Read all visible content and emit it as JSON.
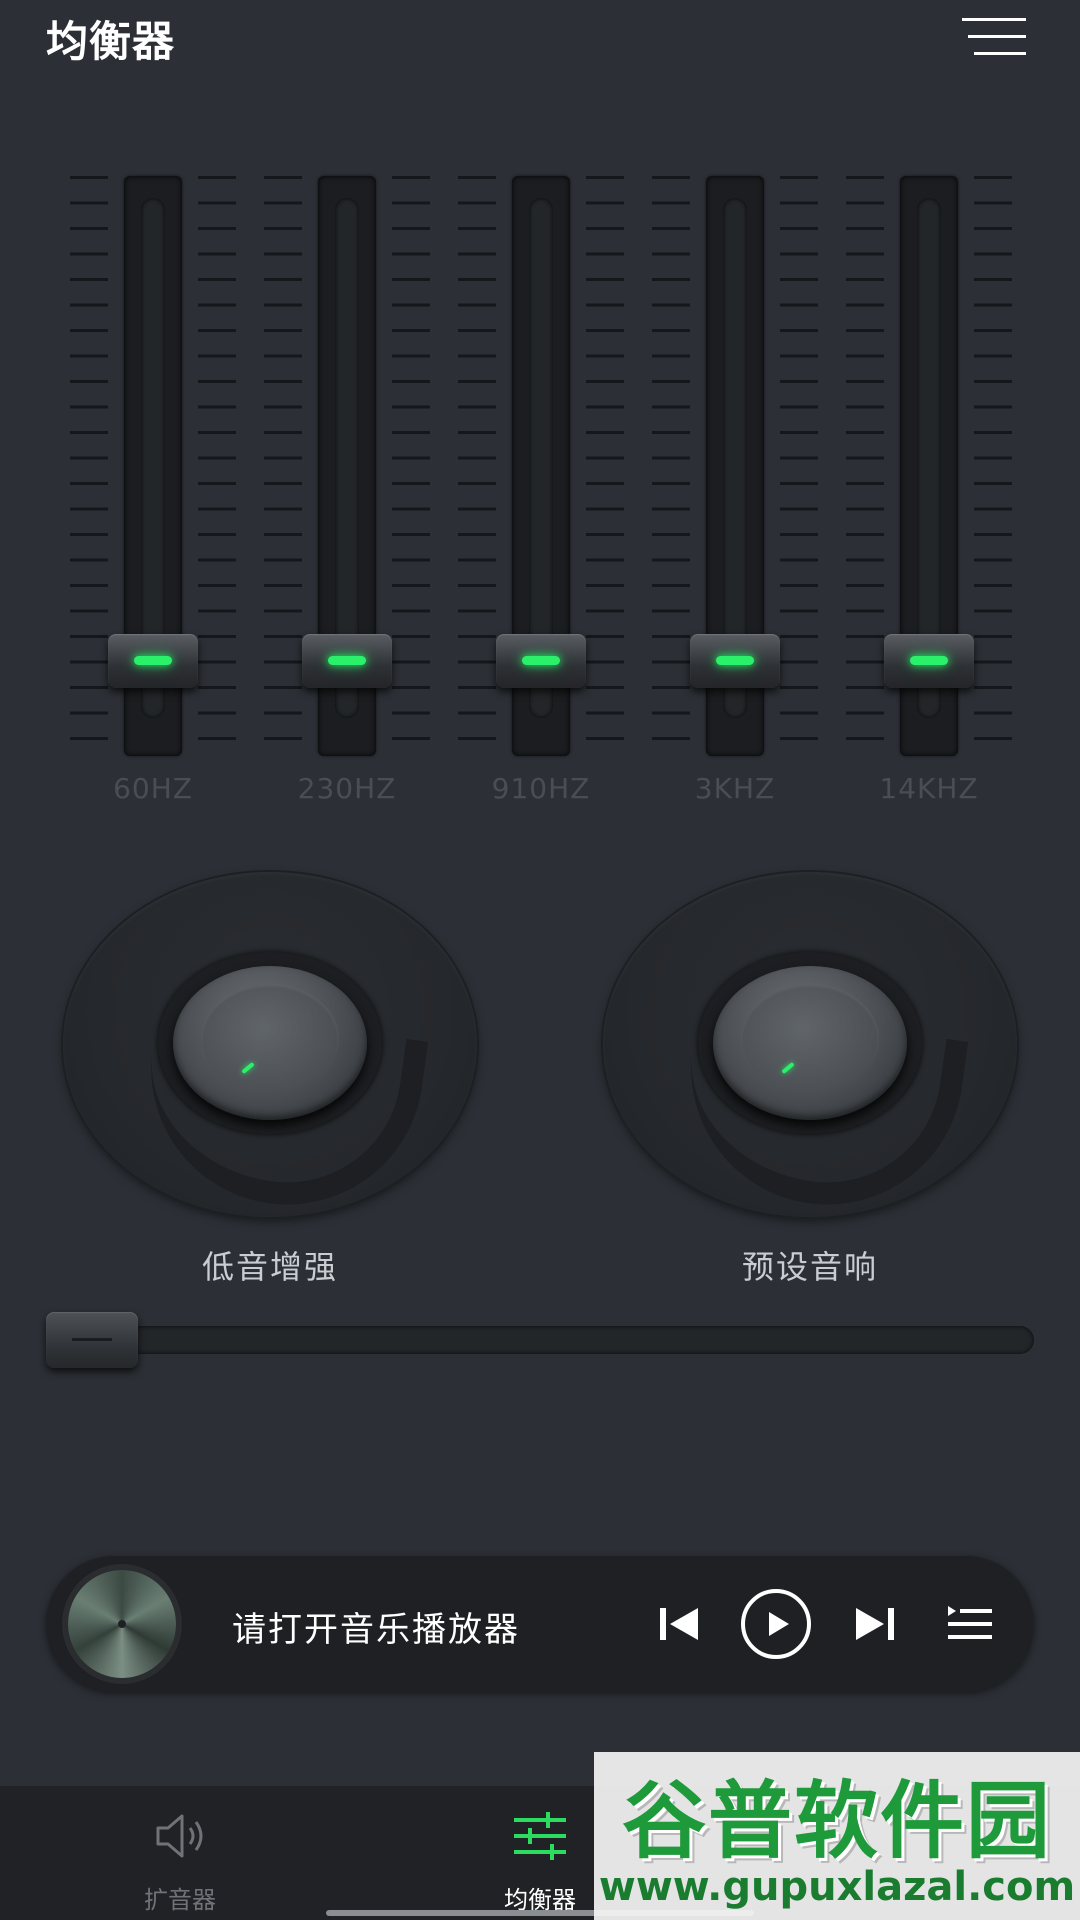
{
  "header": {
    "title": "均衡器",
    "menu_icon": "menu-icon"
  },
  "equalizer": {
    "bands": [
      {
        "label": "60HZ",
        "level": 0.12
      },
      {
        "label": "230HZ",
        "level": 0.12
      },
      {
        "label": "910HZ",
        "level": 0.12
      },
      {
        "label": "3KHZ",
        "level": 0.12
      },
      {
        "label": "14KHZ",
        "level": 0.12
      }
    ],
    "led_color": "#2bf06a"
  },
  "knobs": {
    "bass": {
      "label": "低音增强"
    },
    "preset": {
      "label": "预设音响"
    }
  },
  "volume_slider": {
    "level": 0.0
  },
  "player": {
    "text": "请打开音乐播放器",
    "controls": [
      "prev-icon",
      "play-icon",
      "next-icon",
      "playlist-icon"
    ]
  },
  "nav": {
    "items": [
      {
        "label": "扩音器",
        "icon": "speaker-icon",
        "active": false
      },
      {
        "label": "均衡器",
        "icon": "equalizer-icon",
        "active": true
      }
    ],
    "active_color": "#2bdc5e",
    "inactive_color": "#6f7377"
  },
  "watermark": {
    "title": "谷普软件园",
    "url": "www.gupuxlazal.com"
  }
}
